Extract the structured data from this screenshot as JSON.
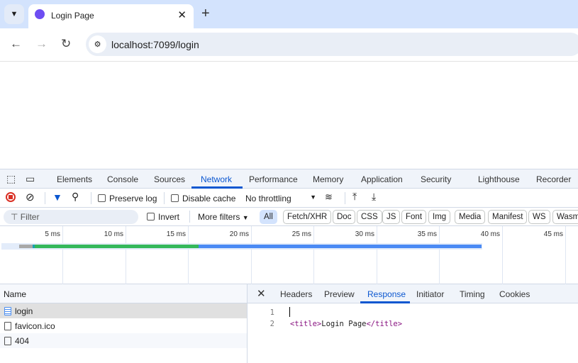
{
  "browser": {
    "tab_title": "Login Page",
    "url": "localhost:7099/login"
  },
  "devtools": {
    "tabs": [
      "Elements",
      "Console",
      "Sources",
      "Network",
      "Performance",
      "Memory",
      "Application",
      "Security",
      "Lighthouse",
      "Recorder"
    ],
    "active_tab": "Network",
    "toolbar": {
      "preserve_log": "Preserve log",
      "disable_cache": "Disable cache",
      "throttling": "No throttling"
    },
    "filter": {
      "placeholder": "Filter",
      "invert": "Invert",
      "more_filters": "More filters",
      "types": [
        "All",
        "Fetch/XHR",
        "Doc",
        "CSS",
        "JS",
        "Font",
        "Img",
        "Media",
        "Manifest",
        "WS",
        "Wasm"
      ]
    },
    "overview": {
      "ticks": [
        "5 ms",
        "10 ms",
        "15 ms",
        "20 ms",
        "25 ms",
        "30 ms",
        "35 ms",
        "40 ms",
        "45 ms"
      ]
    },
    "requests": {
      "header": "Name",
      "rows": [
        "login",
        "favicon.ico",
        "404"
      ]
    },
    "detail": {
      "tabs": [
        "Headers",
        "Preview",
        "Response",
        "Initiator",
        "Timing",
        "Cookies"
      ],
      "active": "Response",
      "lines": [
        {
          "n": "1",
          "open": "",
          "text": "",
          "close": ""
        },
        {
          "n": "2",
          "open": "<title>",
          "text": "Login Page",
          "close": "</title>"
        }
      ]
    }
  }
}
